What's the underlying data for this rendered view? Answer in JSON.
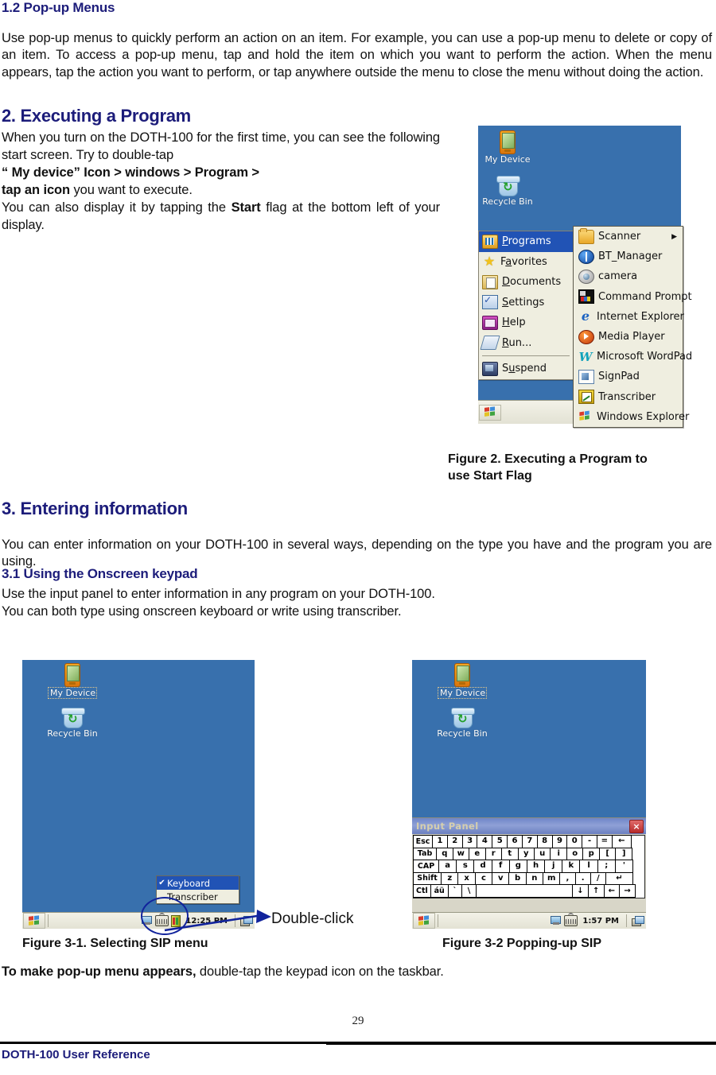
{
  "doc": {
    "page_number": "29",
    "footer_text": "DOTH-100 User Reference"
  },
  "section_1_2": {
    "title": "1.2 Pop-up Menus",
    "body": "Use pop-up menus to quickly perform an action on an item. For example, you can use a pop-up menu to delete or copy of an item. To access a pop-up menu, tap and hold the item on which you want to perform the action. When the menu appears, tap the action you want to perform, or tap anywhere outside the menu to close the menu without doing the action."
  },
  "section_2": {
    "title": "2. Executing a Program",
    "para1": "When you turn on the DOTH-100 for the first time, you can see the following start screen. Try to double-tap",
    "bold_line1": "“ My device”  Icon > windows > Program >",
    "bold_line2": "tap an icon",
    "after_bold": " you want to execute.",
    "para2_a": "You can also display it by tapping the ",
    "para2_b": "Start",
    "para2_c": " flag at the bottom left of your display."
  },
  "figure2": {
    "caption_line1": "Figure 2. Executing a Program to",
    "caption_line2": "use Start Flag",
    "desktop": {
      "icons": [
        {
          "name": "My Device",
          "icon": "pda-icon"
        },
        {
          "name": "Recycle Bin",
          "icon": "recycle-bin-icon"
        }
      ]
    },
    "start_menu": [
      {
        "label": "Programs",
        "accel": "P",
        "icon": "programs-icon",
        "highlighted": true
      },
      {
        "label": "Favorites",
        "accel": "a",
        "icon": "star-icon",
        "highlighted": false
      },
      {
        "label": "Documents",
        "accel": "D",
        "icon": "documents-icon",
        "highlighted": false
      },
      {
        "label": "Settings",
        "accel": "S",
        "icon": "settings-icon",
        "highlighted": false
      },
      {
        "label": "Help",
        "accel": "H",
        "icon": "help-icon",
        "highlighted": false
      },
      {
        "label": "Run...",
        "accel": "R",
        "icon": "run-icon",
        "highlighted": false
      },
      {
        "label": "Suspend",
        "accel": "u",
        "icon": "suspend-icon",
        "highlighted": false
      }
    ],
    "submenu": [
      {
        "label": "Scanner",
        "icon": "folder-icon",
        "has_submenu": true
      },
      {
        "label": "BT_Manager",
        "icon": "bluetooth-icon",
        "has_submenu": false
      },
      {
        "label": "camera",
        "icon": "camera-icon",
        "has_submenu": false
      },
      {
        "label": "Command Prompt",
        "icon": "command-prompt-icon",
        "has_submenu": false
      },
      {
        "label": "Internet Explorer",
        "icon": "internet-explorer-icon",
        "has_submenu": false
      },
      {
        "label": "Media Player",
        "icon": "media-player-icon",
        "has_submenu": false
      },
      {
        "label": "Microsoft WordPad",
        "icon": "wordpad-icon",
        "has_submenu": false
      },
      {
        "label": "SignPad",
        "icon": "signpad-icon",
        "has_submenu": false
      },
      {
        "label": "Transcriber",
        "icon": "transcriber-icon",
        "has_submenu": false
      },
      {
        "label": "Windows Explorer",
        "icon": "windows-explorer-icon",
        "has_submenu": false
      }
    ],
    "submenu_arrow": "▶"
  },
  "section_3": {
    "title": "3. Entering information",
    "body": "You can enter information on your DOTH-100 in several ways, depending on the type you have and the program you are using."
  },
  "section_3_1": {
    "title": "3.1 Using the Onscreen keypad",
    "line1": "Use the input panel to enter information in any program on your DOTH-100.",
    "line2": "You can both type using onscreen keyboard or write using transcriber."
  },
  "figure3_1": {
    "caption": "Figure 3-1. Selecting SIP menu",
    "desktop_icons": [
      {
        "name": "My Device",
        "icon": "pda-icon"
      },
      {
        "name": "Recycle Bin",
        "icon": "recycle-bin-icon"
      }
    ],
    "sip_menu": [
      {
        "label": "Keyboard",
        "checked": true,
        "check_glyph": "✔"
      },
      {
        "label": "Transcriber",
        "checked": false,
        "check_glyph": ""
      }
    ],
    "taskbar_time": "12:25 PM",
    "annotation": "Double-click",
    "annotation_color": "#11239c"
  },
  "figure3_2": {
    "caption": "Figure 3-2 Popping-up SIP",
    "desktop_icons": [
      {
        "name": "My Device",
        "icon": "pda-icon"
      },
      {
        "name": "Recycle Bin",
        "icon": "recycle-bin-icon"
      }
    ],
    "input_panel": {
      "title": "Input Panel",
      "close_glyph": "×",
      "rows": [
        [
          "Esc",
          "1",
          "2",
          "3",
          "4",
          "5",
          "6",
          "7",
          "8",
          "9",
          "0",
          "-",
          "=",
          "←"
        ],
        [
          "Tab",
          "q",
          "w",
          "e",
          "r",
          "t",
          "y",
          "u",
          "i",
          "o",
          "p",
          "[",
          "]"
        ],
        [
          "CAP",
          "a",
          "s",
          "d",
          "f",
          "g",
          "h",
          "j",
          "k",
          "l",
          ";",
          "'"
        ],
        [
          "Shift",
          "z",
          "x",
          "c",
          "v",
          "b",
          "n",
          "m",
          ",",
          ".",
          "/",
          "↵"
        ],
        [
          "Ctl",
          "áü",
          "`",
          "\\",
          " ",
          "↓",
          "↑",
          "←",
          "→"
        ]
      ]
    },
    "taskbar_time": "1:57 PM"
  },
  "closing": {
    "bold": "To make pop-up menu appears,",
    "rest": " double-tap the keypad icon on the taskbar."
  },
  "colors": {
    "heading_blue": "#1c1c7a",
    "desktop_blue": "#3870ad",
    "menu_highlight": "#2153b5",
    "menu_bg": "#efeee0",
    "annotation_blue": "#11239c"
  }
}
